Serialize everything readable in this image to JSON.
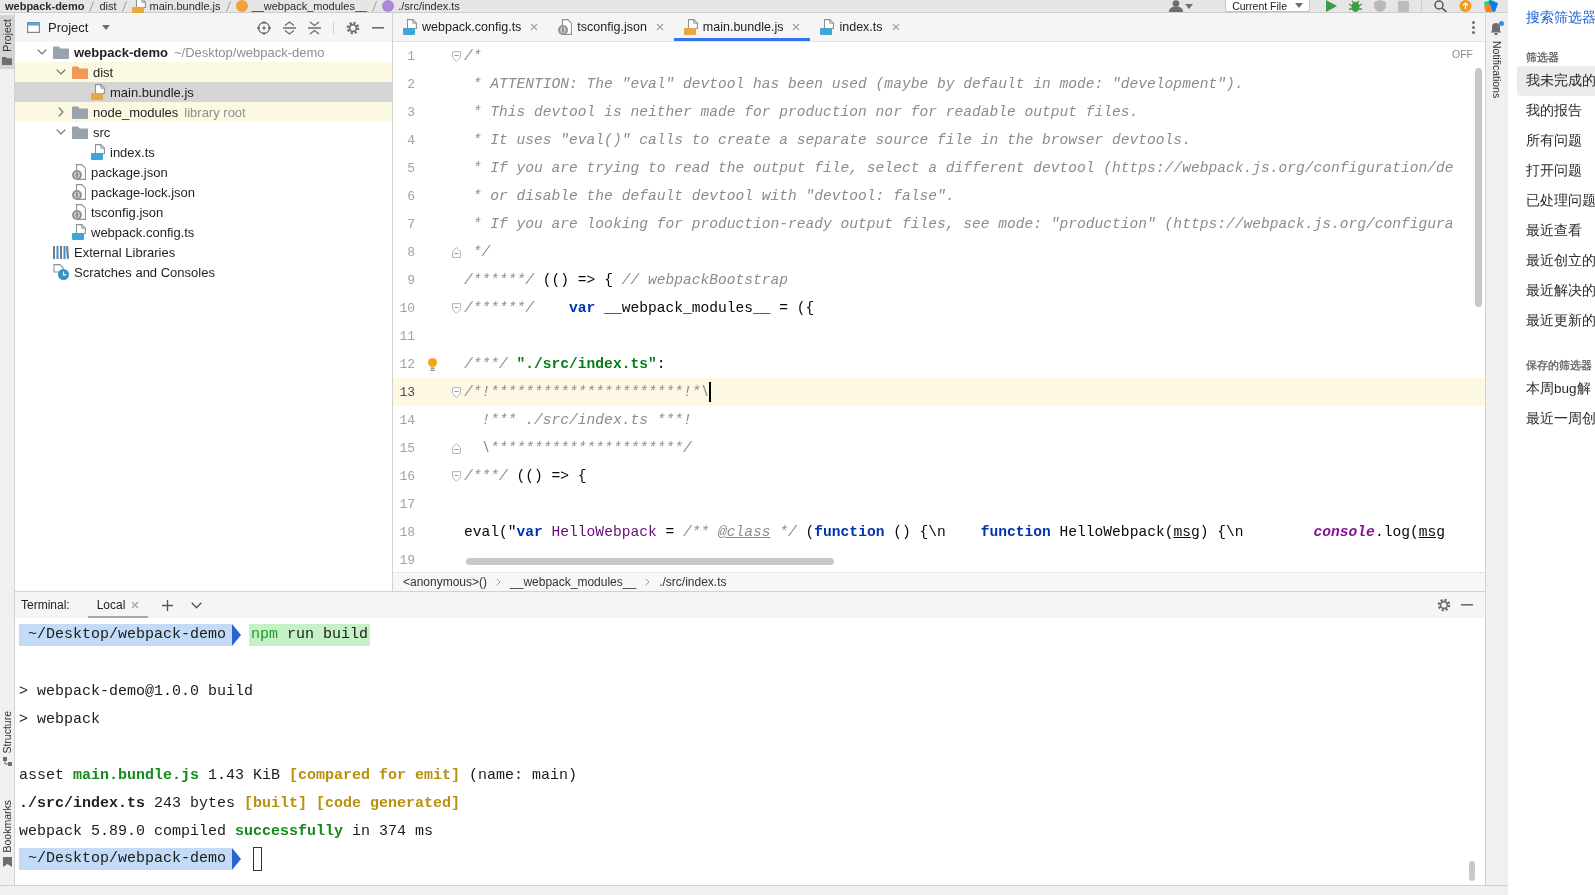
{
  "top_bar": {
    "breadcrumbs": [
      {
        "label": "webpack-demo",
        "kind": "project"
      },
      {
        "label": "dist",
        "kind": "folder"
      },
      {
        "label": "main.bundle.js",
        "kind": "js"
      },
      {
        "label": "__webpack_modules__",
        "kind": "variable"
      },
      {
        "label": "./src/index.ts",
        "kind": "property"
      }
    ],
    "run_configuration": "Current File"
  },
  "left_stripe": {
    "top": [
      {
        "label": "Project",
        "selected": true
      }
    ],
    "bottom": [
      {
        "label": "Structure",
        "selected": false
      },
      {
        "label": "Bookmarks",
        "selected": false
      }
    ]
  },
  "project_panel": {
    "title": "Project",
    "tree": [
      {
        "name": "webpack-demo",
        "hint": "~/Desktop/webpack-demo",
        "kind": "module",
        "expanded": true,
        "selected": false,
        "highlighted": false,
        "children": [
          {
            "name": "dist",
            "kind": "excluded-folder",
            "expanded": true,
            "selected": false,
            "highlighted": true,
            "children": [
              {
                "name": "main.bundle.js",
                "kind": "js",
                "selected": true,
                "highlighted": false
              }
            ]
          },
          {
            "name": "node_modules",
            "hint": "library root",
            "kind": "folder",
            "expanded": false,
            "selected": false,
            "highlighted": true
          },
          {
            "name": "src",
            "kind": "folder",
            "expanded": true,
            "selected": false,
            "highlighted": false,
            "children": [
              {
                "name": "index.ts",
                "kind": "ts",
                "selected": false,
                "highlighted": false
              }
            ]
          },
          {
            "name": "package.json",
            "kind": "json",
            "selected": false,
            "highlighted": false
          },
          {
            "name": "package-lock.json",
            "kind": "json",
            "selected": false,
            "highlighted": false
          },
          {
            "name": "tsconfig.json",
            "kind": "json",
            "selected": false,
            "highlighted": false
          },
          {
            "name": "webpack.config.ts",
            "kind": "ts",
            "selected": false,
            "highlighted": false
          }
        ]
      },
      {
        "name": "External Libraries",
        "kind": "libraries",
        "selected": false,
        "highlighted": false
      },
      {
        "name": "Scratches and Consoles",
        "kind": "scratches",
        "selected": false,
        "highlighted": false
      }
    ]
  },
  "editor": {
    "tabs": [
      {
        "label": "webpack.config.ts",
        "kind": "ts",
        "selected": false
      },
      {
        "label": "tsconfig.json",
        "kind": "json",
        "selected": false
      },
      {
        "label": "main.bundle.js",
        "kind": "js",
        "selected": true
      },
      {
        "label": "index.ts",
        "kind": "ts",
        "selected": false
      }
    ],
    "status": "OFF",
    "lines": [
      {
        "number": "1",
        "kind": "fold-start",
        "bulb": false,
        "current": false,
        "segments": [
          {
            "text": "/*",
            "kind": "comment"
          }
        ]
      },
      {
        "number": "2",
        "kind": "plain",
        "bulb": false,
        "current": false,
        "segments": [
          {
            "text": " * ATTENTION: The \"eval\" devtool has been used (maybe by default in mode: \"development\").",
            "kind": "comment"
          }
        ]
      },
      {
        "number": "3",
        "kind": "plain",
        "bulb": false,
        "current": false,
        "segments": [
          {
            "text": " * This devtool is neither made for production nor for readable output files.",
            "kind": "comment"
          }
        ]
      },
      {
        "number": "4",
        "kind": "plain",
        "bulb": false,
        "current": false,
        "segments": [
          {
            "text": " * It uses \"eval()\" calls to create a separate source file in the browser devtools.",
            "kind": "comment"
          }
        ]
      },
      {
        "number": "5",
        "kind": "plain",
        "bulb": false,
        "current": false,
        "segments": [
          {
            "text": " * If you are trying to read the output file, select a different devtool (https://webpack.js.org/configuration/de",
            "kind": "comment"
          }
        ]
      },
      {
        "number": "6",
        "kind": "plain",
        "bulb": false,
        "current": false,
        "segments": [
          {
            "text": " * or disable the default devtool with \"devtool: false\".",
            "kind": "comment"
          }
        ]
      },
      {
        "number": "7",
        "kind": "plain",
        "bulb": false,
        "current": false,
        "segments": [
          {
            "text": " * If you are looking for production-ready output files, see mode: \"production\" (https://webpack.js.org/configura",
            "kind": "comment"
          }
        ]
      },
      {
        "number": "8",
        "kind": "fold-end",
        "bulb": false,
        "current": false,
        "segments": [
          {
            "text": " */",
            "kind": "comment"
          }
        ]
      },
      {
        "number": "9",
        "kind": "plain",
        "bulb": false,
        "current": false,
        "segments": [
          {
            "text": "/******/ ",
            "kind": "comment"
          },
          {
            "text": "(() => { ",
            "kind": "plain"
          },
          {
            "text": "// webpackBootstrap",
            "kind": "comment"
          }
        ]
      },
      {
        "number": "10",
        "kind": "fold-start",
        "bulb": false,
        "current": false,
        "segments": [
          {
            "text": "/******/    ",
            "kind": "comment"
          },
          {
            "text": "var",
            "kind": "keyword"
          },
          {
            "text": " __webpack_modules__ = ({",
            "kind": "plain"
          }
        ]
      },
      {
        "number": "11",
        "kind": "plain",
        "bulb": false,
        "current": false
      },
      {
        "number": "12",
        "kind": "plain",
        "bulb": true,
        "current": false,
        "segments": [
          {
            "text": "/***/ ",
            "kind": "comment"
          },
          {
            "text": "\"./src/index.ts\"",
            "kind": "string"
          },
          {
            "text": ":",
            "kind": "plain"
          }
        ]
      },
      {
        "number": "13",
        "kind": "fold-start",
        "bulb": false,
        "current": true,
        "segments": [
          {
            "text": "/*!**********************!*\\",
            "kind": "comment"
          }
        ]
      },
      {
        "number": "14",
        "kind": "plain",
        "bulb": false,
        "current": false,
        "segments": [
          {
            "text": "  !*** ./src/index.ts ***!",
            "kind": "comment"
          }
        ]
      },
      {
        "number": "15",
        "kind": "fold-end",
        "bulb": false,
        "current": false,
        "segments": [
          {
            "text": "  \\**********************/",
            "kind": "comment"
          }
        ]
      },
      {
        "number": "16",
        "kind": "fold-start",
        "bulb": false,
        "current": false,
        "segments": [
          {
            "text": "/***/",
            "kind": "comment"
          },
          {
            "text": " (() => {",
            "kind": "plain"
          }
        ]
      },
      {
        "number": "17",
        "kind": "plain",
        "bulb": false,
        "current": false
      },
      {
        "number": "18",
        "kind": "plain",
        "bulb": false,
        "current": false,
        "segments": [
          {
            "text": "eval(\"",
            "kind": "plain"
          },
          {
            "text": "var",
            "kind": "keyword"
          },
          {
            "text": " HelloWebpack",
            "kind": "global"
          },
          {
            "text": " = ",
            "kind": "plain"
          },
          {
            "text": "/** ",
            "kind": "comment"
          },
          {
            "text": "@class",
            "kind": "doc-tag"
          },
          {
            "text": " */",
            "kind": "comment"
          },
          {
            "text": " (",
            "kind": "plain"
          },
          {
            "text": "function",
            "kind": "keyword"
          },
          {
            "text": " () {\\n    ",
            "kind": "plain"
          },
          {
            "text": "function",
            "kind": "keyword"
          },
          {
            "text": " HelloWebpack(",
            "kind": "plain"
          },
          {
            "text": "msg",
            "kind": "param"
          },
          {
            "text": ") {\\n        ",
            "kind": "plain"
          },
          {
            "text": "console",
            "kind": "builtin"
          },
          {
            "text": ".log(",
            "kind": "plain"
          },
          {
            "text": "msg",
            "kind": "param"
          }
        ]
      },
      {
        "number": "19",
        "kind": "plain",
        "bulb": false,
        "current": false
      }
    ],
    "breadcrumbs": [
      "<anonymous>()",
      "__webpack_modules__",
      "./src/index.ts"
    ]
  },
  "terminal": {
    "title": "Terminal:",
    "tabs": [
      {
        "label": "Local",
        "selected": true
      }
    ],
    "lines": [
      {
        "kind": "prompt",
        "path": "~/Desktop/webpack-demo",
        "cursor": false,
        "command": [
          {
            "text": "npm",
            "kind": "program"
          },
          {
            "text": " run build",
            "kind": "plain"
          }
        ]
      },
      {
        "kind": "blank"
      },
      {
        "kind": "output",
        "segments": [
          {
            "text": "> webpack-demo@1.0.0 build",
            "kind": "plain"
          }
        ]
      },
      {
        "kind": "output",
        "segments": [
          {
            "text": "> webpack",
            "kind": "plain"
          }
        ]
      },
      {
        "kind": "blank"
      },
      {
        "kind": "output",
        "segments": [
          {
            "text": "asset ",
            "kind": "plain"
          },
          {
            "text": "main.bundle.js",
            "kind": "success"
          },
          {
            "text": " 1.43 KiB ",
            "kind": "plain"
          },
          {
            "text": "[compared for emit]",
            "kind": "note"
          },
          {
            "text": " (name: main)",
            "kind": "plain"
          }
        ]
      },
      {
        "kind": "output",
        "segments": [
          {
            "text": "./src/index.ts",
            "kind": "bold"
          },
          {
            "text": " 243 bytes ",
            "kind": "plain"
          },
          {
            "text": "[built] [code generated]",
            "kind": "note"
          }
        ]
      },
      {
        "kind": "output",
        "segments": [
          {
            "text": "webpack 5.89.0 compiled ",
            "kind": "plain"
          },
          {
            "text": "successfully",
            "kind": "success"
          },
          {
            "text": " in 374 ms",
            "kind": "plain"
          }
        ]
      },
      {
        "kind": "prompt",
        "path": "~/Desktop/webpack-demo",
        "cursor": true
      }
    ]
  },
  "notifications_stripe": {
    "label": "Notifications"
  },
  "filter_panel": {
    "search_link": "搜索筛选器",
    "sections": [
      {
        "heading": "筛选器",
        "items": [
          {
            "label": "我未完成的",
            "selected": true
          },
          {
            "label": "我的报告",
            "selected": false
          },
          {
            "label": "所有问题",
            "selected": false
          },
          {
            "label": "打开问题",
            "selected": false
          },
          {
            "label": "已处理问题",
            "selected": false
          },
          {
            "label": "最近查看",
            "selected": false
          },
          {
            "label": "最近创立的",
            "selected": false
          },
          {
            "label": "最近解决的",
            "selected": false
          },
          {
            "label": "最近更新的",
            "selected": false
          }
        ]
      },
      {
        "heading": "保存的筛选器",
        "items": [
          {
            "label": "本周bug解",
            "selected": false
          },
          {
            "label": "最近一周创",
            "selected": false
          }
        ]
      }
    ]
  }
}
